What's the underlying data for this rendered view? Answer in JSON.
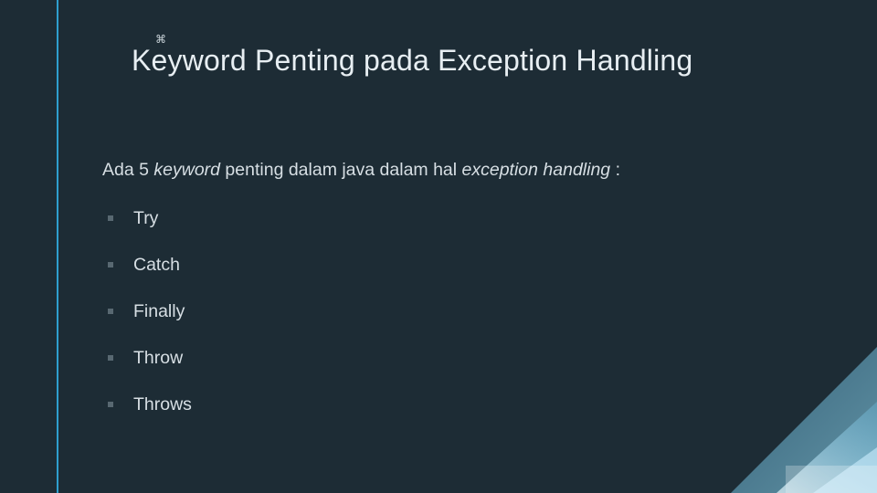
{
  "title": "Keyword Penting pada Exception Handling",
  "decor_glyph": "⌘",
  "intro": {
    "prefix": "Ada 5 ",
    "keyword_italic": "keyword",
    "middle": " penting dalam java dalam hal ",
    "eh_italic": "exception handling",
    "suffix": " :"
  },
  "items": [
    {
      "label": "Try"
    },
    {
      "label": "Catch"
    },
    {
      "label": "Finally"
    },
    {
      "label": "Throw"
    },
    {
      "label": "Throws"
    }
  ],
  "colors": {
    "bg": "#1d2c35",
    "accent": "#2f9fcf"
  }
}
